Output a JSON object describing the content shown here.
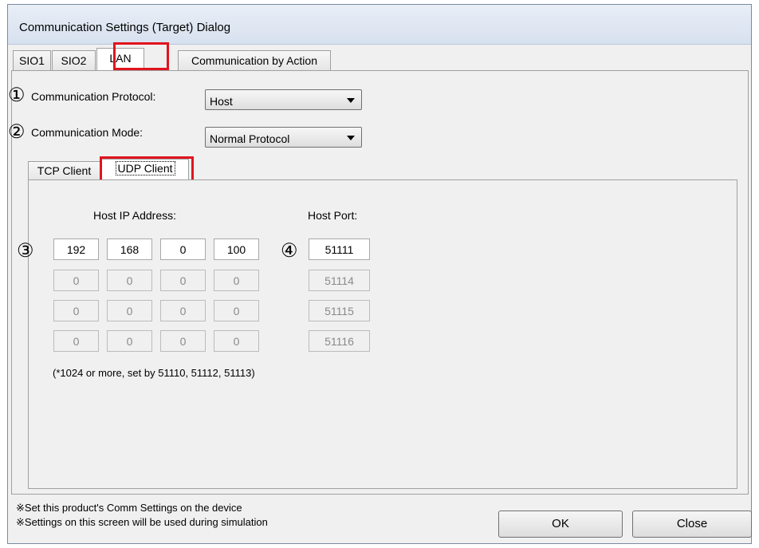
{
  "window": {
    "title": "Communication Settings (Target) Dialog"
  },
  "tabs": [
    {
      "label": "SIO1"
    },
    {
      "label": "SIO2"
    },
    {
      "label": "LAN"
    },
    {
      "label": "Communication by Action"
    }
  ],
  "markers": {
    "m1": "①",
    "m2": "②",
    "m3": "③",
    "m4": "④"
  },
  "protocol": {
    "label": "Communication Protocol:",
    "value": "Host"
  },
  "mode": {
    "label": "Communication Mode:",
    "value": "Normal Protocol"
  },
  "inner_tabs": [
    {
      "label": "TCP Client"
    },
    {
      "label": "UDP Client"
    }
  ],
  "host": {
    "ip_header": "Host IP Address:",
    "port_header": "Host Port:",
    "rows": [
      {
        "ip": [
          "192",
          "168",
          "0",
          "100"
        ],
        "port": "51111"
      },
      {
        "ip": [
          "0",
          "0",
          "0",
          "0"
        ],
        "port": "51114"
      },
      {
        "ip": [
          "0",
          "0",
          "0",
          "0"
        ],
        "port": "51115"
      },
      {
        "ip": [
          "0",
          "0",
          "0",
          "0"
        ],
        "port": "51116"
      }
    ],
    "note": "(*1024 or more, set by 51110, 51112, 51113)"
  },
  "footer": {
    "note1": "※Set this product's Comm Settings on the device",
    "note2": "※Settings on this screen will be used during simulation",
    "ok_label": "OK",
    "close_label": "Close"
  },
  "colors": {
    "highlight": "#e0141e",
    "title_bar": "#d7e1ef",
    "face": "#f0f0f0"
  }
}
